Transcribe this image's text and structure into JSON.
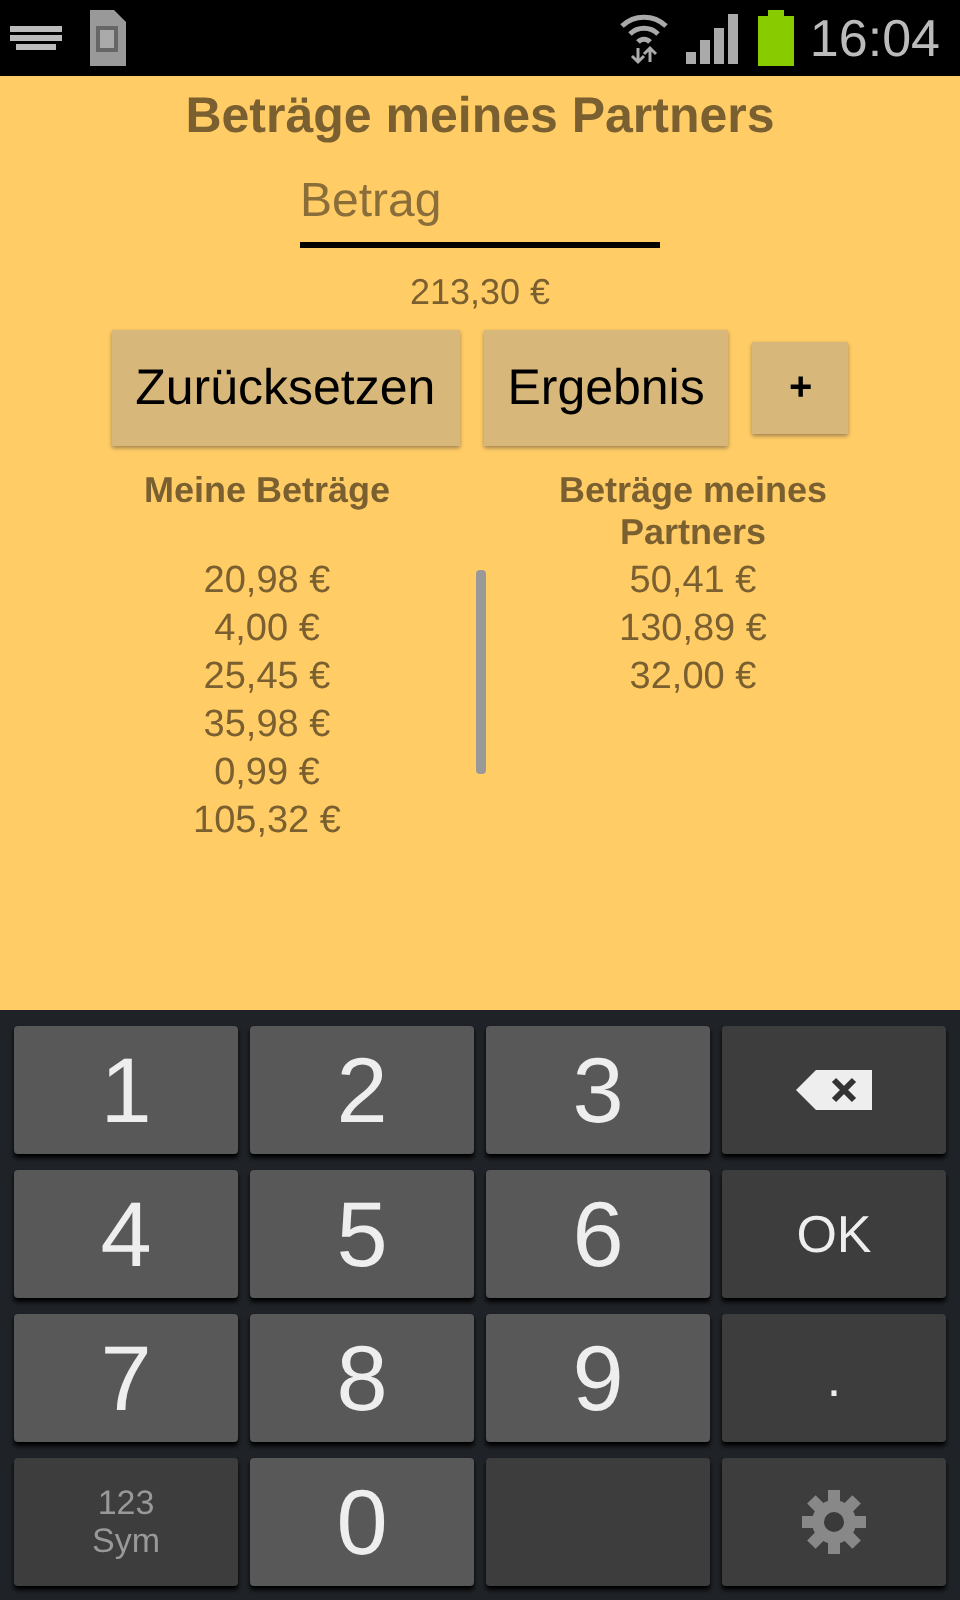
{
  "status_bar": {
    "time": "16:04"
  },
  "title": "Beträge meines Partners",
  "amount_field": {
    "placeholder": "Betrag"
  },
  "total": "213,30 €",
  "buttons": [
    {
      "label": "Zurücksetzen",
      "kind": "wide"
    },
    {
      "label": "Ergebnis",
      "kind": "wide"
    },
    {
      "label": "+",
      "kind": "small"
    }
  ],
  "columns": [
    {
      "heading": "Meine Beträge",
      "values": [
        "20,98 €",
        "4,00 €",
        "25,45 €",
        "35,98 €",
        "0,99 €",
        "105,32 €"
      ]
    },
    {
      "heading": "Beträge meines Partners",
      "values": [
        "50,41 €",
        "130,89 €",
        "32,00 €"
      ]
    }
  ],
  "keyboard": {
    "keys": [
      {
        "kind": "digit",
        "label": "1"
      },
      {
        "kind": "digit",
        "label": "2"
      },
      {
        "kind": "digit",
        "label": "3"
      },
      {
        "kind": "backspace"
      },
      {
        "kind": "digit",
        "label": "4"
      },
      {
        "kind": "digit",
        "label": "5"
      },
      {
        "kind": "digit",
        "label": "6"
      },
      {
        "kind": "action",
        "label": "OK"
      },
      {
        "kind": "digit",
        "label": "7"
      },
      {
        "kind": "digit",
        "label": "8"
      },
      {
        "kind": "digit",
        "label": "9"
      },
      {
        "kind": "action",
        "label": "."
      },
      {
        "kind": "sym",
        "label": "123",
        "sublabel": "Sym"
      },
      {
        "kind": "digit",
        "label": "0"
      },
      {
        "kind": "space"
      },
      {
        "kind": "settings"
      }
    ]
  }
}
